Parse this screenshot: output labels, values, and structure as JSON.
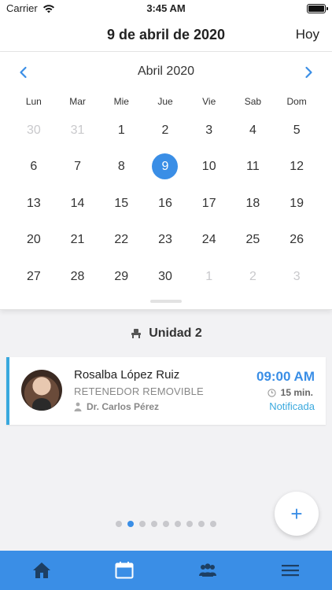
{
  "status_bar": {
    "carrier": "Carrier",
    "time": "3:45 AM",
    "icons": [
      "wifi-icon",
      "battery-icon"
    ]
  },
  "header": {
    "title": "9 de abril de 2020",
    "today_button": "Hoy"
  },
  "calendar": {
    "month_label": "Abril 2020",
    "prev_icon": "chevron-left-icon",
    "next_icon": "chevron-right-icon",
    "weekdays": [
      "Lun",
      "Mar",
      "Mie",
      "Jue",
      "Vie",
      "Sab",
      "Dom"
    ],
    "days": [
      {
        "label": "30",
        "muted": true
      },
      {
        "label": "31",
        "muted": true
      },
      {
        "label": "1"
      },
      {
        "label": "2"
      },
      {
        "label": "3"
      },
      {
        "label": "4"
      },
      {
        "label": "5"
      },
      {
        "label": "6"
      },
      {
        "label": "7"
      },
      {
        "label": "8"
      },
      {
        "label": "9",
        "selected": true
      },
      {
        "label": "10"
      },
      {
        "label": "11"
      },
      {
        "label": "12"
      },
      {
        "label": "13"
      },
      {
        "label": "14"
      },
      {
        "label": "15"
      },
      {
        "label": "16"
      },
      {
        "label": "17"
      },
      {
        "label": "18"
      },
      {
        "label": "19"
      },
      {
        "label": "20"
      },
      {
        "label": "21"
      },
      {
        "label": "22"
      },
      {
        "label": "23"
      },
      {
        "label": "24"
      },
      {
        "label": "25"
      },
      {
        "label": "26"
      },
      {
        "label": "27"
      },
      {
        "label": "28"
      },
      {
        "label": "29"
      },
      {
        "label": "30"
      },
      {
        "label": "1",
        "muted": true
      },
      {
        "label": "2",
        "muted": true
      },
      {
        "label": "3",
        "muted": true
      }
    ],
    "selected_color": "#3a8ee6"
  },
  "unit": {
    "icon": "dental-chair-icon",
    "label": "Unidad 2"
  },
  "appointment": {
    "patient_name": "Rosalba López Ruiz",
    "treatment": "RETENEDOR REMOVIBLE",
    "doctor": "Dr. Carlos Pérez",
    "doctor_icon": "doctor-icon",
    "time": "09:00 AM",
    "duration": "15 min.",
    "duration_icon": "clock-icon",
    "status": "Notificada",
    "accent_color": "#3aa9de"
  },
  "pager": {
    "count": 9,
    "active_index": 1
  },
  "fab": {
    "label": "+",
    "icon": "plus-icon"
  },
  "tabbar": {
    "background": "#3a8ee6",
    "tabs": [
      {
        "icon": "home-icon"
      },
      {
        "icon": "calendar-icon"
      },
      {
        "icon": "patients-icon"
      },
      {
        "icon": "menu-icon"
      }
    ]
  }
}
